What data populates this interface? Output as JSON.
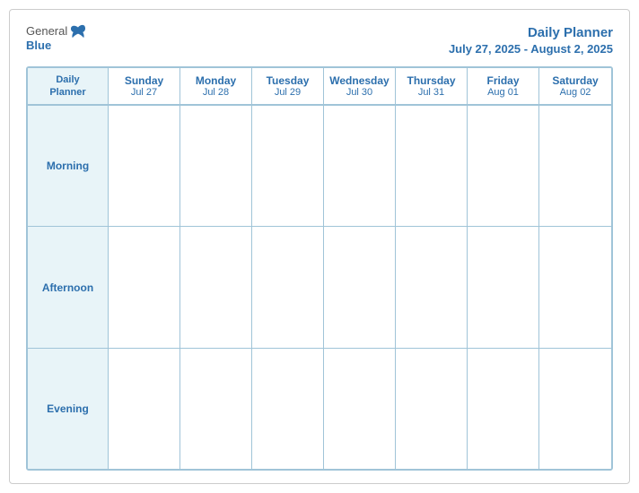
{
  "logo": {
    "general": "General",
    "blue": "Blue",
    "bird_unicode": "🐦"
  },
  "title": {
    "main": "Daily Planner",
    "date_range": "July 27, 2025 - August 2, 2025"
  },
  "calendar": {
    "header_label_line1": "Daily",
    "header_label_line2": "Planner",
    "days": [
      {
        "name": "Sunday",
        "date": "Jul 27"
      },
      {
        "name": "Monday",
        "date": "Jul 28"
      },
      {
        "name": "Tuesday",
        "date": "Jul 29"
      },
      {
        "name": "Wednesday",
        "date": "Jul 30"
      },
      {
        "name": "Thursday",
        "date": "Jul 31"
      },
      {
        "name": "Friday",
        "date": "Aug 01"
      },
      {
        "name": "Saturday",
        "date": "Aug 02"
      }
    ],
    "rows": [
      {
        "label": "Morning"
      },
      {
        "label": "Afternoon"
      },
      {
        "label": "Evening"
      }
    ]
  }
}
